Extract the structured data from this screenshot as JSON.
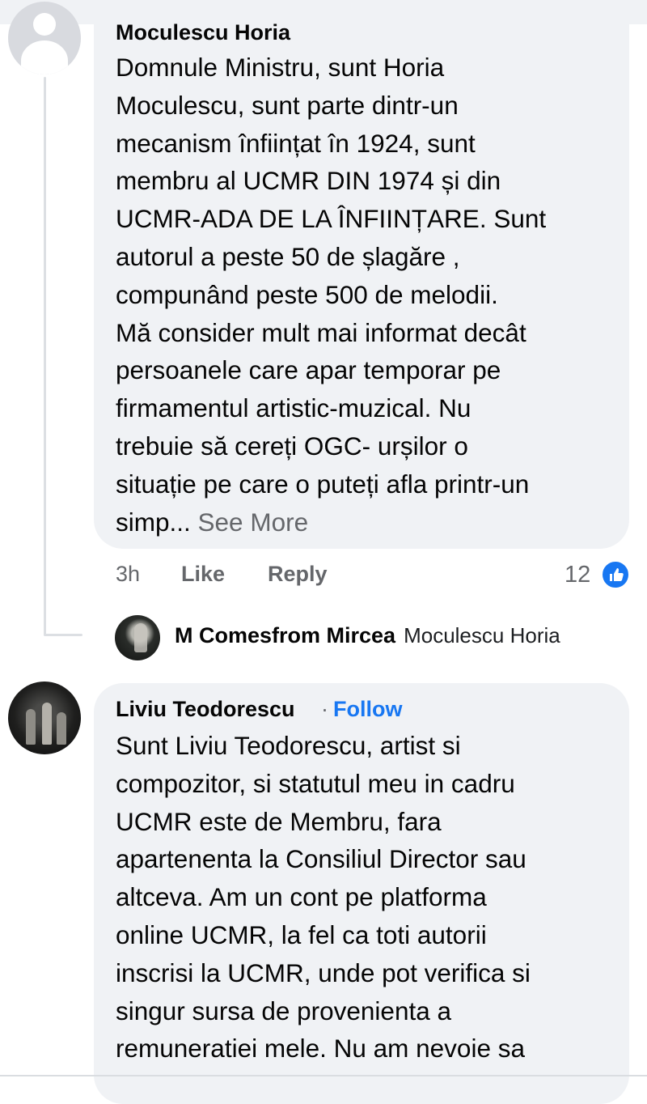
{
  "comments": [
    {
      "author": "Moculescu Horia",
      "avatar_icon": "default-user-avatar-icon",
      "text_lines": [
        "Domnule Ministru, sunt Horia",
        "Moculescu, sunt parte dintr-un",
        "mecanism înființat în 1924, sunt",
        "membru al UCMR DIN 1974 și din",
        "UCMR-ADA DE LA ÎNFIINȚARE. Sunt",
        "autorul a peste 50 de șlagăre ,",
        "compunând peste 500 de melodii.",
        "Mă consider mult mai informat decât",
        "persoanele care apar temporar pe",
        "firmamentul artistic-muzical. Nu",
        "trebuie să cereți OGC- urșilor o",
        "situație pe care o puteți afla printr-un"
      ],
      "last_line_start": "simp...",
      "see_more": "See More",
      "time": "3h",
      "like_label": "Like",
      "reply_label": "Reply",
      "reaction_count": "12",
      "reaction_icon": "thumbs-up-icon"
    },
    {
      "author": "Liviu Teodorescu",
      "separator": "·",
      "follow_label": "Follow",
      "text_lines": [
        "Sunt Liviu Teodorescu, artist si",
        "compozitor, si statutul meu in cadru",
        "UCMR este de Membru, fara",
        "apartenenta la Consiliul Director sau",
        "altceva. Am un cont pe platforma",
        "online UCMR, la fel ca toti autorii",
        "inscrisi la UCMR, unde pot verifica si",
        "singur sursa de provenienta a",
        "remuneratiei mele. Nu am nevoie sa"
      ]
    }
  ],
  "reply_preview": {
    "author": "M Comesfrom Mircea",
    "mention": "Moculescu Horia"
  },
  "colors": {
    "bubble": "#f0f2f5",
    "link_blue": "#1877f2",
    "secondary_text": "#65676b"
  }
}
